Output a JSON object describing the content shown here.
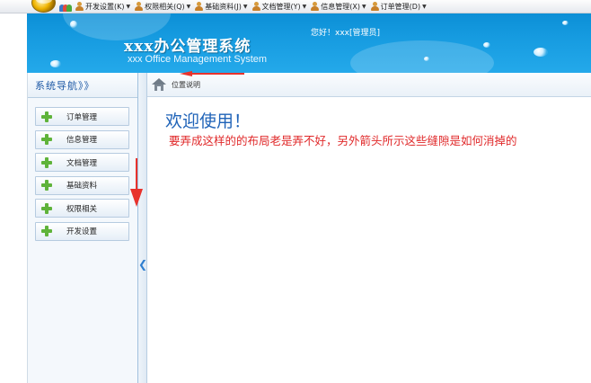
{
  "menubar": {
    "items": [
      {
        "label": "开发设置",
        "hotkey": "(K)"
      },
      {
        "label": "权限相关",
        "hotkey": "(Q)"
      },
      {
        "label": "基础资料",
        "hotkey": "(J)"
      },
      {
        "label": "文档管理",
        "hotkey": "(Y)"
      },
      {
        "label": "信息管理",
        "hotkey": "(X)"
      },
      {
        "label": "订单管理",
        "hotkey": "(D)"
      }
    ]
  },
  "header": {
    "title": "xxx办公管理系统",
    "subtitle": "xxx Office Management System",
    "greeting": "您好！xxx[管理员]"
  },
  "sidebar": {
    "title": "系统导航》》",
    "items": [
      {
        "label": "订单管理"
      },
      {
        "label": "信息管理"
      },
      {
        "label": "文档管理"
      },
      {
        "label": "基础资料"
      },
      {
        "label": "权限相关"
      },
      {
        "label": "开发设置"
      }
    ]
  },
  "main": {
    "breadcrumb": "位置说明",
    "welcome": "欢迎使用！",
    "note": "要弄成这样的的布局老是弄不好，另外箭头所示这些缝隙是如何消掉的"
  },
  "colors": {
    "header_blue": "#169be0",
    "annotation_red": "#e0292a",
    "welcome_blue": "#1f63b8",
    "plus_green": "#5fb33a"
  }
}
